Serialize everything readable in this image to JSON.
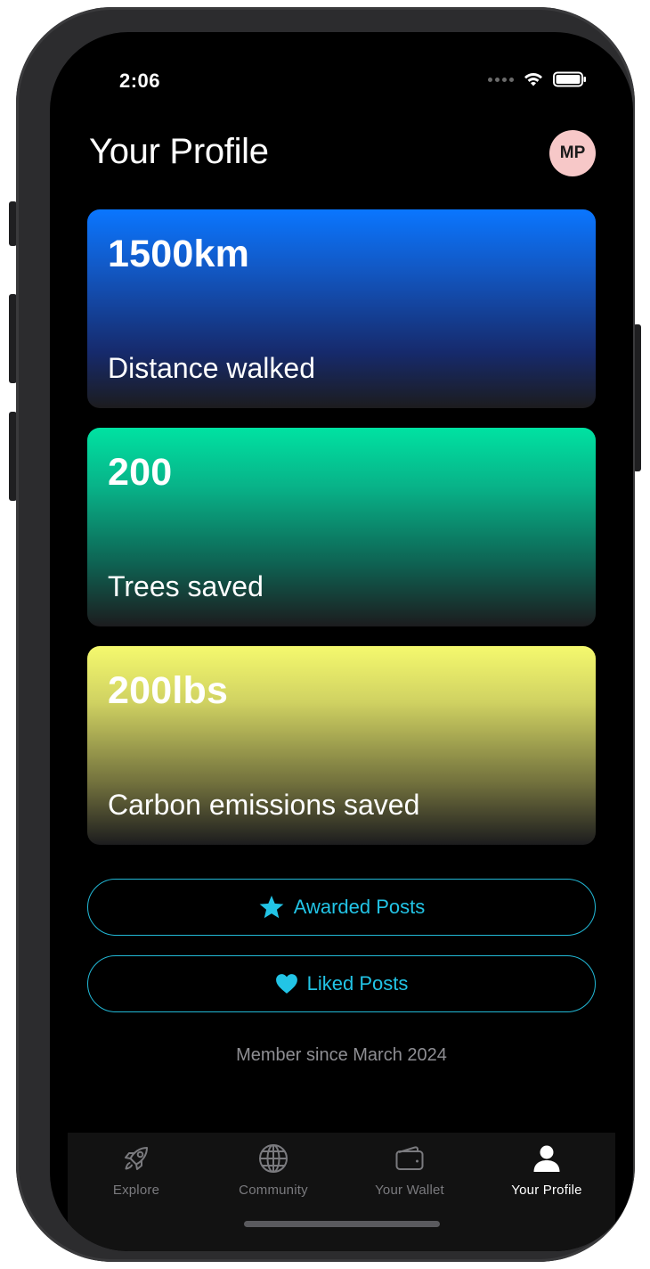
{
  "status_bar": {
    "time": "2:06"
  },
  "header": {
    "title": "Your Profile",
    "avatar_initials": "MP",
    "avatar_color": "#f7c8c8"
  },
  "stats": [
    {
      "value": "1500km",
      "label": "Distance walked",
      "color": "#0a76ff"
    },
    {
      "value": "200",
      "label": "Trees saved",
      "color": "#00e2a2"
    },
    {
      "value": "200lbs",
      "label": "Carbon emissions saved",
      "color": "#f5f96e"
    }
  ],
  "actions": {
    "awarded_label": "Awarded Posts",
    "awarded_icon": "star-icon",
    "liked_label": "Liked Posts",
    "liked_icon": "heart-icon",
    "accent_color": "#22c4e6"
  },
  "member_since": "Member since March 2024",
  "tab_bar": {
    "items": [
      {
        "label": "Explore",
        "icon": "rocket-icon",
        "active": false
      },
      {
        "label": "Community",
        "icon": "globe-icon",
        "active": false
      },
      {
        "label": "Your Wallet",
        "icon": "wallet-icon",
        "active": false
      },
      {
        "label": "Your Profile",
        "icon": "person-icon",
        "active": true
      }
    ]
  }
}
